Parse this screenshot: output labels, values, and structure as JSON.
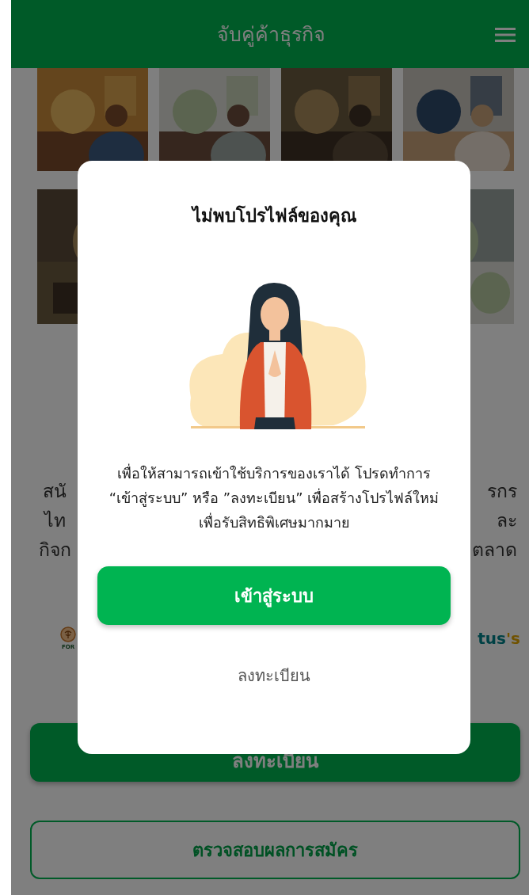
{
  "header": {
    "title": "จับคู่ค้าธุรกิจ"
  },
  "intro_fragments": {
    "left": [
      "สนั",
      "ไท",
      "กิจก"
    ],
    "right": [
      "รกร",
      "ละ",
      "ตลาด"
    ]
  },
  "partner_logos": [
    {
      "kind": "emblem",
      "caption": "FOR"
    },
    {
      "kind": "wordmark",
      "text": "tus",
      "suffix": "'s"
    }
  ],
  "register_button": "ลงทะเบียน",
  "check_button": "ตรวจสอบผลการสมัคร",
  "dialog": {
    "title": "ไม่พบโปรไฟล์ของคุณ",
    "message": "เพื่อให้สามารถเข้าใช้บริการของเราได้ โปรดทำการ “เข้าสู่ระบบ” หรือ ”ลงทะเบียน” เพื่อสร้างโปรไฟล์ใหม่เพื่อรับสิทธิพิเศษมากมาย",
    "primary": "เข้าสู่ระบบ",
    "secondary": "ลงทะเบียน"
  }
}
